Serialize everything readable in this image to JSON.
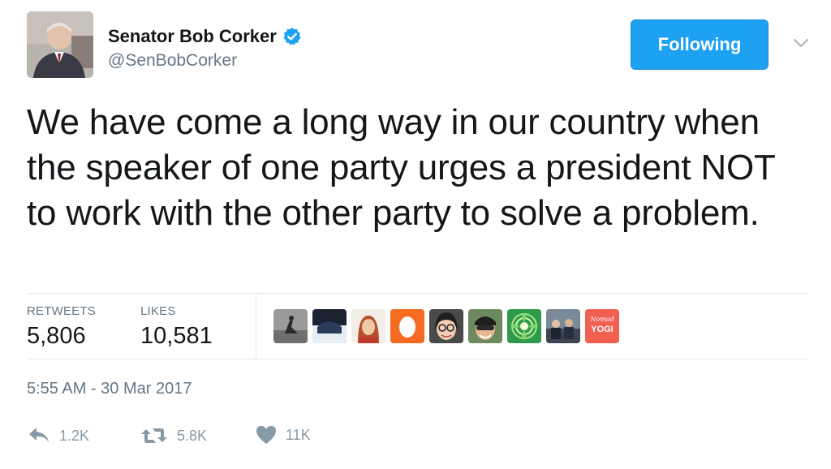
{
  "author": {
    "name": "Senator Bob Corker",
    "handle": "@SenBobCorker",
    "verified": true,
    "avatar": "profile-photo"
  },
  "follow_button": {
    "label": "Following",
    "color": "#1da1f2"
  },
  "tweet": {
    "text": "We have come a long way in our country when the speaker of one party urges a president NOT to work with the other party to solve a problem."
  },
  "stats": {
    "retweets_label": "RETWEETS",
    "retweets_value": "5,806",
    "likes_label": "LIKES",
    "likes_value": "10,581"
  },
  "likers": [
    {
      "avatar": "silhouette-photo"
    },
    {
      "avatar": "dark-photo"
    },
    {
      "avatar": "red-hair-photo"
    },
    {
      "avatar": "orange-egg"
    },
    {
      "avatar": "glasses-woman-photo"
    },
    {
      "avatar": "sunglasses-man-photo"
    },
    {
      "avatar": "green-mandala"
    },
    {
      "avatar": "group-photo"
    },
    {
      "avatar": "nomad-yogi-logo",
      "logo_text_top": "Nomad",
      "logo_text_main": "YOGI"
    }
  ],
  "timestamp": "5:55 AM - 30 Mar 2017",
  "actions": {
    "reply_count": "1.2K",
    "retweet_count": "5.8K",
    "like_count": "11K"
  },
  "colors": {
    "text": "#14171a",
    "secondary": "#657786",
    "accent": "#1da1f2",
    "action": "#8899a6"
  }
}
